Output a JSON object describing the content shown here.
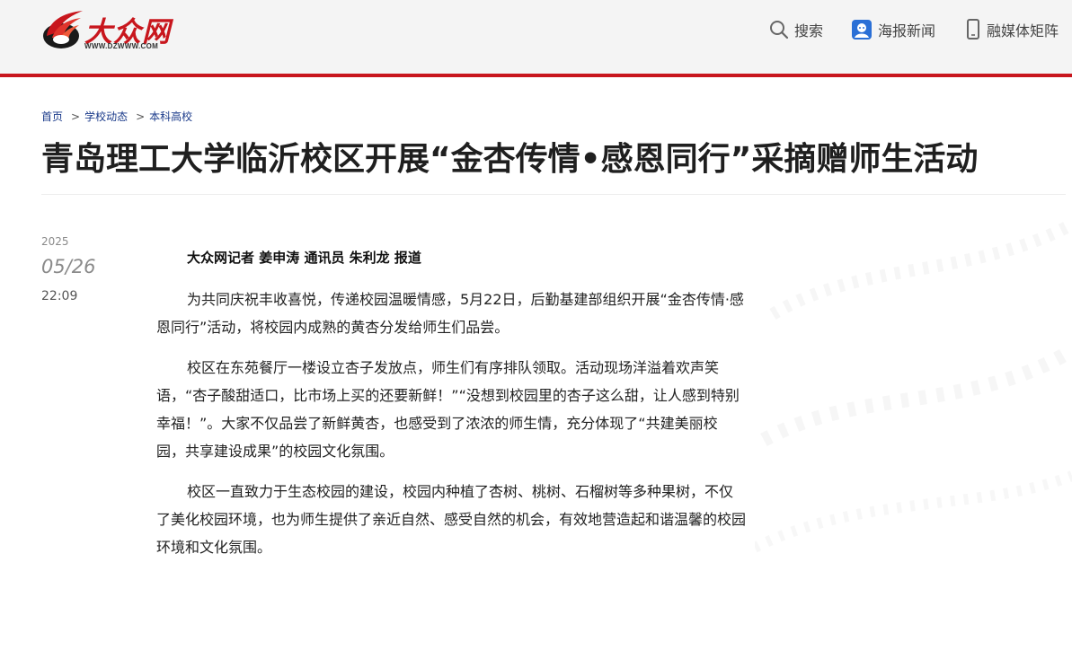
{
  "header": {
    "logo": {
      "text": "大众网",
      "url_text": "WWW.DZWWW.COM"
    },
    "nav": [
      {
        "label": "搜索",
        "icon": "search-icon"
      },
      {
        "label": "海报新闻",
        "icon": "poster-news-icon"
      },
      {
        "label": "融媒体矩阵",
        "icon": "phone-icon"
      }
    ]
  },
  "breadcrumb": [
    "首页",
    "学校动态",
    "本科高校"
  ],
  "article": {
    "title": "青岛理工大学临沂校区开展“金杏传情•感恩同行”采摘赠师生活动",
    "date": {
      "year": "2025",
      "month_day": "05/26",
      "time": "22:09"
    },
    "byline": "大众网记者 姜申涛 通讯员 朱利龙 报道",
    "paragraphs": [
      "为共同庆祝丰收喜悦，传递校园温暖情感，5月22日，后勤基建部组织开展“金杏传情·感恩同行”活动，将校园内成熟的黄杏分发给师生们品尝。",
      "校区在东苑餐厅一楼设立杏子发放点，师生们有序排队领取。活动现场洋溢着欢声笑语，“杏子酸甜适口，比市场上买的还要新鲜！”“没想到校园里的杏子这么甜，让人感到特别幸福！”。大家不仅品尝了新鲜黄杏，也感受到了浓浓的师生情，充分体现了“共建美丽校园，共享建设成果”的校园文化氛围。",
      "校区一直致力于生态校园的建设，校园内种植了杏树、桃树、石榴树等多种果树，不仅了美化校园环境，也为师生提供了亲近自然、感受自然的机会，有效地营造起和谐温馨的校园环境和文化氛围。"
    ]
  },
  "colors": {
    "brand_red": "#c8161d",
    "link_blue": "#1a3a8a",
    "header_bg": "#f4f4f4"
  }
}
